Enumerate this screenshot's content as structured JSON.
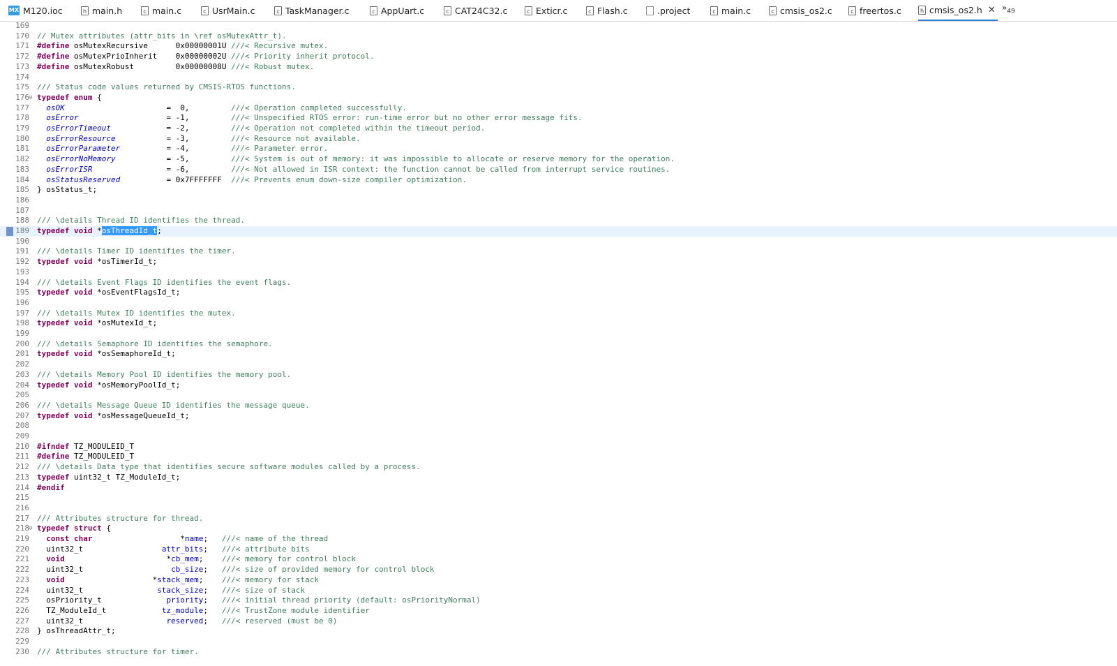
{
  "tabs": [
    {
      "label": "M120.ioc",
      "icon": "mx"
    },
    {
      "label": "main.h",
      "icon": "h"
    },
    {
      "label": "main.c",
      "icon": "c"
    },
    {
      "label": "UsrMain.c",
      "icon": "c"
    },
    {
      "label": "TaskManager.c",
      "icon": "c"
    },
    {
      "label": "AppUart.c",
      "icon": "c"
    },
    {
      "label": "CAT24C32.c",
      "icon": "c"
    },
    {
      "label": "Exticr.c",
      "icon": "c"
    },
    {
      "label": "Flash.c",
      "icon": "c"
    },
    {
      "label": ".project",
      "icon": "proj"
    },
    {
      "label": "main.c",
      "icon": "c"
    },
    {
      "label": "cmsis_os2.c",
      "icon": "c"
    },
    {
      "label": "freertos.c",
      "icon": "c"
    },
    {
      "label": "cmsis_os2.h",
      "icon": "h",
      "active": true
    }
  ],
  "overflow": {
    "chevron": "»",
    "count": "49"
  },
  "editor": {
    "current_line": "189",
    "lines": [
      {
        "n": "169",
        "t": ""
      },
      {
        "n": "170",
        "t": "// Mutex attributes (attr_bits in \\ref osMutexAttr_t)."
      },
      {
        "n": "171",
        "t": "#define osMutexRecursive      0x00000001U ///< Recursive mutex."
      },
      {
        "n": "172",
        "t": "#define osMutexPrioInherit    0x00000002U ///< Priority inherit protocol."
      },
      {
        "n": "173",
        "t": "#define osMutexRobust         0x00000008U ///< Robust mutex."
      },
      {
        "n": "174",
        "t": ""
      },
      {
        "n": "175",
        "t": "/// Status code values returned by CMSIS-RTOS functions."
      },
      {
        "n": "176",
        "t": "typedef enum {",
        "fold": true
      },
      {
        "n": "177",
        "t": "  osOK                      =  0,         ///< Operation completed successfully."
      },
      {
        "n": "178",
        "t": "  osError                   = -1,         ///< Unspecified RTOS error: run-time error but no other error message fits."
      },
      {
        "n": "179",
        "t": "  osErrorTimeout            = -2,         ///< Operation not completed within the timeout period."
      },
      {
        "n": "180",
        "t": "  osErrorResource           = -3,         ///< Resource not available."
      },
      {
        "n": "181",
        "t": "  osErrorParameter          = -4,         ///< Parameter error."
      },
      {
        "n": "182",
        "t": "  osErrorNoMemory           = -5,         ///< System is out of memory: it was impossible to allocate or reserve memory for the operation."
      },
      {
        "n": "183",
        "t": "  osErrorISR                = -6,         ///< Not allowed in ISR context: the function cannot be called from interrupt service routines."
      },
      {
        "n": "184",
        "t": "  osStatusReserved          = 0x7FFFFFFF  ///< Prevents enum down-size compiler optimization."
      },
      {
        "n": "185",
        "t": "} osStatus_t;"
      },
      {
        "n": "186",
        "t": ""
      },
      {
        "n": "187",
        "t": ""
      },
      {
        "n": "188",
        "t": "/// \\details Thread ID identifies the thread."
      },
      {
        "n": "189",
        "t": "typedef void *osThreadId_t;",
        "sel": "osThreadId_t"
      },
      {
        "n": "190",
        "t": ""
      },
      {
        "n": "191",
        "t": "/// \\details Timer ID identifies the timer."
      },
      {
        "n": "192",
        "t": "typedef void *osTimerId_t;"
      },
      {
        "n": "193",
        "t": ""
      },
      {
        "n": "194",
        "t": "/// \\details Event Flags ID identifies the event flags."
      },
      {
        "n": "195",
        "t": "typedef void *osEventFlagsId_t;"
      },
      {
        "n": "196",
        "t": ""
      },
      {
        "n": "197",
        "t": "/// \\details Mutex ID identifies the mutex."
      },
      {
        "n": "198",
        "t": "typedef void *osMutexId_t;"
      },
      {
        "n": "199",
        "t": ""
      },
      {
        "n": "200",
        "t": "/// \\details Semaphore ID identifies the semaphore."
      },
      {
        "n": "201",
        "t": "typedef void *osSemaphoreId_t;"
      },
      {
        "n": "202",
        "t": ""
      },
      {
        "n": "203",
        "t": "/// \\details Memory Pool ID identifies the memory pool."
      },
      {
        "n": "204",
        "t": "typedef void *osMemoryPoolId_t;"
      },
      {
        "n": "205",
        "t": ""
      },
      {
        "n": "206",
        "t": "/// \\details Message Queue ID identifies the message queue."
      },
      {
        "n": "207",
        "t": "typedef void *osMessageQueueId_t;"
      },
      {
        "n": "208",
        "t": ""
      },
      {
        "n": "209",
        "t": ""
      },
      {
        "n": "210",
        "t": "#ifndef TZ_MODULEID_T"
      },
      {
        "n": "211",
        "t": "#define TZ_MODULEID_T"
      },
      {
        "n": "212",
        "t": "/// \\details Data type that identifies secure software modules called by a process."
      },
      {
        "n": "213",
        "t": "typedef uint32_t TZ_ModuleId_t;"
      },
      {
        "n": "214",
        "t": "#endif"
      },
      {
        "n": "215",
        "t": ""
      },
      {
        "n": "216",
        "t": ""
      },
      {
        "n": "217",
        "t": "/// Attributes structure for thread."
      },
      {
        "n": "218",
        "t": "typedef struct {",
        "fold": true
      },
      {
        "n": "219",
        "t": "  const char                   *name;   ///< name of the thread"
      },
      {
        "n": "220",
        "t": "  uint32_t                 attr_bits;   ///< attribute bits"
      },
      {
        "n": "221",
        "t": "  void                      *cb_mem;    ///< memory for control block"
      },
      {
        "n": "222",
        "t": "  uint32_t                   cb_size;   ///< size of provided memory for control block"
      },
      {
        "n": "223",
        "t": "  void                   *stack_mem;    ///< memory for stack"
      },
      {
        "n": "224",
        "t": "  uint32_t                stack_size;   ///< size of stack"
      },
      {
        "n": "225",
        "t": "  osPriority_t              priority;   ///< initial thread priority (default: osPriorityNormal)"
      },
      {
        "n": "226",
        "t": "  TZ_ModuleId_t            tz_module;   ///< TrustZone module identifier"
      },
      {
        "n": "227",
        "t": "  uint32_t                  reserved;   ///< reserved (must be 0)"
      },
      {
        "n": "228",
        "t": "} osThreadAttr_t;"
      },
      {
        "n": "229",
        "t": ""
      },
      {
        "n": "230",
        "t": "/// Attributes structure for timer."
      }
    ]
  }
}
